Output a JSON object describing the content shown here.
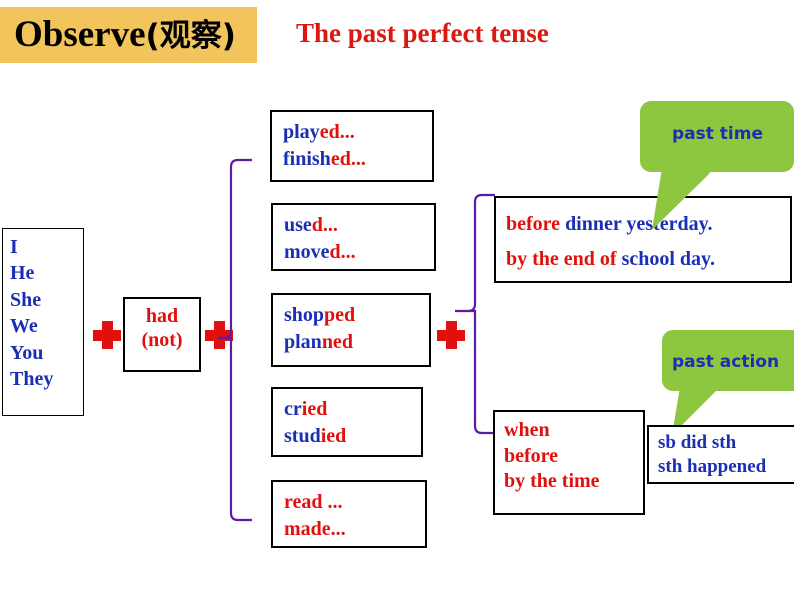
{
  "header": {
    "observe_en": "Observe",
    "observe_cn": "(观察)",
    "title": "The past perfect  tense"
  },
  "colors": {
    "banner": "#F2C55C",
    "title_red": "#D9190F",
    "text_blue": "#1B2FB5",
    "text_red": "#E2100C",
    "callout_green": "#8DC63F",
    "connector_purple": "#5B1BA8"
  },
  "subject_box": {
    "name": "pronouns",
    "items": [
      "I",
      "He",
      "She",
      "We",
      "You",
      "They"
    ]
  },
  "auxiliary_box": {
    "line1": "had",
    "line2": "(not)"
  },
  "operators": {
    "plus1": "+",
    "plus2": "+",
    "plus3": "+"
  },
  "verb_boxes": [
    {
      "lines": [
        {
          "stem": "play",
          "ending": "ed..."
        },
        {
          "stem": "finish",
          "ending": "ed..."
        }
      ]
    },
    {
      "lines": [
        {
          "stem": "use",
          "ending": "d..."
        },
        {
          "stem": "move",
          "ending": "d..."
        }
      ]
    },
    {
      "lines": [
        {
          "stem": "shop",
          "ending": "ped"
        },
        {
          "stem": "plan",
          "ending": "ned"
        }
      ]
    },
    {
      "lines": [
        {
          "stem": "cr",
          "ending": "ied"
        },
        {
          "stem": "stud",
          "ending": "ied"
        }
      ]
    },
    {
      "lines": [
        {
          "stem": "",
          "ending": "read ..."
        },
        {
          "stem": "",
          "ending": "made..."
        }
      ]
    }
  ],
  "time_box": {
    "lines": [
      {
        "marker": "before",
        "phrase": " dinner  yesterday."
      },
      {
        "marker": "by the end of",
        "phrase": " school day."
      }
    ]
  },
  "clause_box": {
    "items": [
      "when",
      "before",
      "by the time"
    ]
  },
  "sth_box": {
    "items": [
      "sb did sth",
      "sth happened"
    ]
  },
  "callouts": [
    {
      "label": "past time"
    },
    {
      "label": "past action"
    }
  ]
}
